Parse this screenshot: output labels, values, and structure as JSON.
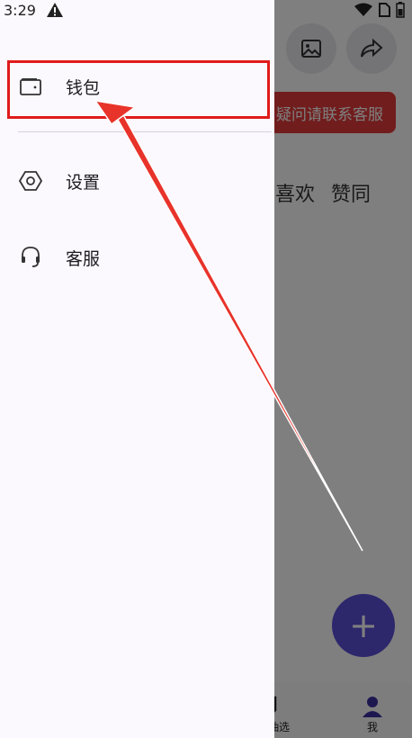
{
  "status_bar": {
    "time": "3:29",
    "icons": [
      "warning-icon",
      "wifi-icon",
      "no-sim-icon",
      "battery-icon"
    ]
  },
  "drawer": {
    "items": [
      {
        "label": "钱包",
        "icon": "wallet-icon"
      },
      {
        "label": "设置",
        "icon": "settings-hexagon-icon"
      },
      {
        "label": "客服",
        "icon": "headset-icon"
      }
    ]
  },
  "background": {
    "pill_text": "疑问请联系客服",
    "tabs": [
      "喜欢",
      "赞同"
    ],
    "fab_label": "+",
    "nav_items": [
      {
        "label": "交易/抽选",
        "icon": "trade-icon"
      },
      {
        "label": "我",
        "icon": "person-icon"
      }
    ]
  },
  "colors": {
    "highlight": "#e01b1b",
    "drawer_bg": "#fbf8fe",
    "fab": "#5b4fd8",
    "pill": "#e23b3b"
  }
}
